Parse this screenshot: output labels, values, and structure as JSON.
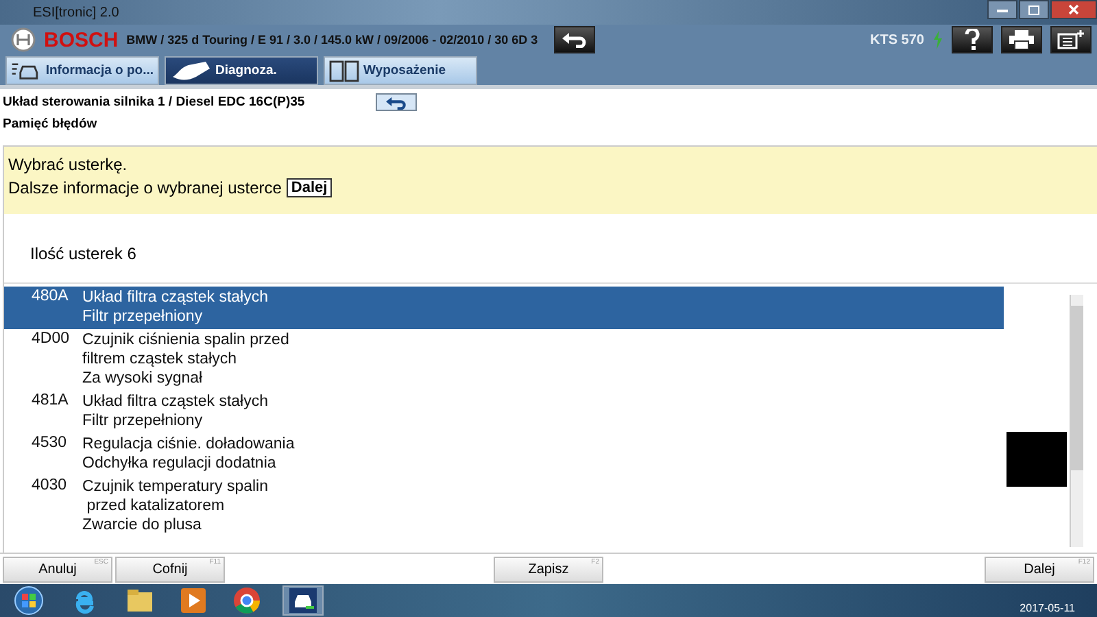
{
  "window": {
    "title": "ESI[tronic] 2.0"
  },
  "header": {
    "brand": "BOSCH",
    "vehicle": "BMW / 325 d Touring / E 91 / 3.0 / 145.0 kW / 09/2006 - 02/2010 / 30 6D 3",
    "device": "KTS 570"
  },
  "tabs": [
    {
      "label": "Informacja o po...",
      "selected": false
    },
    {
      "label": "Diagnoza.",
      "selected": true
    },
    {
      "label": "Wyposażenie",
      "selected": false
    }
  ],
  "breadcrumb": {
    "path": "Układ sterowania silnika 1 / Diesel EDC 16C(P)35",
    "section": "Pamięć błędów"
  },
  "info": {
    "line1": "Wybrać usterkę.",
    "line2": "Dalsze informacje o wybranej usterce",
    "button": "Dalej"
  },
  "count": "Ilość usterek 6",
  "faults": [
    {
      "code": "480A",
      "lines": [
        "Układ filtra cząstek stałych",
        "Filtr przepełniony"
      ],
      "selected": true
    },
    {
      "code": "4D00",
      "lines": [
        "Czujnik ciśnienia spalin przed",
        "filtrem cząstek stałych",
        "Za wysoki sygnał"
      ],
      "selected": false
    },
    {
      "code": "481A",
      "lines": [
        "Układ filtra cząstek stałych",
        "Filtr przepełniony"
      ],
      "selected": false
    },
    {
      "code": "4530",
      "lines": [
        "Regulacja ciśnie. doładowania",
        "Odchyłka regulacji dodatnia"
      ],
      "selected": false
    },
    {
      "code": "4030",
      "lines": [
        "Czujnik temperatury spalin",
        " przed katalizatorem",
        "Zwarcie do plusa"
      ],
      "selected": false
    }
  ],
  "buttons": [
    {
      "label": "Anuluj",
      "key": "ESC"
    },
    {
      "label": "Cofnij",
      "key": "F11"
    },
    {
      "label": "Zapisz",
      "key": "F2"
    },
    {
      "label": "Dalej",
      "key": "F12"
    }
  ],
  "taskbar": {
    "date": "2017-05-11"
  }
}
